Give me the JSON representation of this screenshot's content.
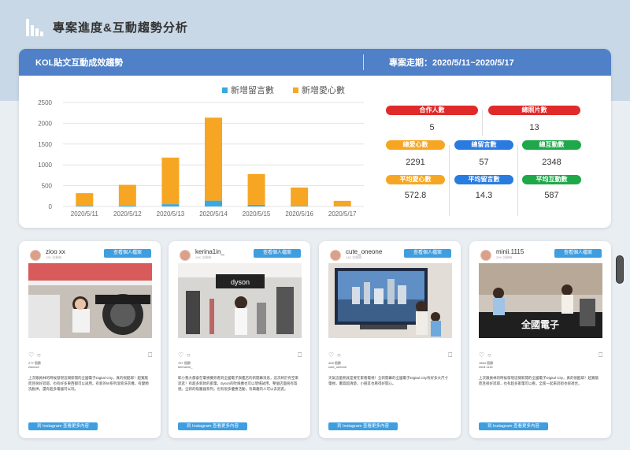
{
  "header": {
    "title": "專案進度&互動趨勢分析",
    "icon": "bar-chart-icon"
  },
  "panel": {
    "title": "KOL貼文互動成效趨勢",
    "period": "專案走期：2020/5/11~2020/5/17",
    "header_color": "#4f80c8"
  },
  "chart_data": {
    "type": "bar",
    "stacked": true,
    "categories": [
      "2020/5/11",
      "2020/5/12",
      "2020/5/13",
      "2020/5/14",
      "2020/5/15",
      "2020/5/16",
      "2020/5/17"
    ],
    "series": [
      {
        "name": "新增留言數",
        "color": "#3ba9e0",
        "values": [
          15,
          22,
          55,
          140,
          40,
          8,
          5
        ]
      },
      {
        "name": "新增愛心數",
        "color": "#f6a623",
        "values": [
          305,
          498,
          1120,
          1995,
          740,
          447,
          130
        ]
      }
    ],
    "ylim": [
      0,
      2500
    ],
    "yticks": [
      0,
      500,
      1000,
      1500,
      2000,
      2500
    ],
    "grid": true,
    "legend": "top"
  },
  "stats": {
    "partners_label": "合作人數",
    "partners_value": "5",
    "photos_label": "總照片數",
    "photos_value": "13",
    "hearts_label": "總愛心數",
    "hearts_value": "2291",
    "comments_label": "總留言數",
    "comments_value": "57",
    "interactions_label": "總互動數",
    "interactions_value": "2348",
    "avg_hearts_label": "平均愛心數",
    "avg_hearts_value": "572.8",
    "avg_comments_label": "平均留言數",
    "avg_comments_value": "14.3",
    "avg_interactions_label": "平均互動數",
    "avg_interactions_value": "587",
    "colors": {
      "red": "#e02a2a",
      "orange": "#f6a623",
      "blue": "#2a7be0",
      "green": "#1fa84a"
    }
  },
  "cards": [
    {
      "username": "zioo xx",
      "followers": "12K 位粉絲",
      "profile_button": "查看個人檔案",
      "likes": "277 個讚",
      "caption_user": "zioooxx",
      "caption": "上次跟員林的時候發現這間新開的全國電子Digital City，真的很酷耶！超寬敞而且很好逛耶，也有好多東西都可以試用。有新的W系列滾筒洗衣機，有變頻洗脫烘，還有超多電器可以玩。",
      "ig_button": "到 Instagram 查看更多內容"
    },
    {
      "username": "kerina1in_",
      "followers": "16K 位粉絲",
      "profile_button": "查看個人檔案",
      "likes": "767 個讚",
      "caption_user": "kerina1in_",
      "caption": "耶小我大都會在電視機旁看到全國電子旗艦店的新開幕消息，這次終於有空來逛逛！有超多新款的家電，dyson的吹風機也可以現場試用，整個店面很有質感。全新的吸塵器系列，也有很多優惠活動，有興趣的人可以去逛逛。",
      "ig_button": "到 Instagram 查看更多內容"
    },
    {
      "username": "cute_oneone",
      "followers": "14K 位粉絲",
      "profile_button": "查看個人檔案",
      "likes": "408 個讚",
      "caption_user": "cute_oneone",
      "caption": "天氣這麼熱就是要在家看電視！全新開幕的全國電子Digital City有好多大尺寸電視，畫質超清楚，小朋友也看得好開心。",
      "ig_button": "到 Instagram 查看更多內容"
    },
    {
      "username": "minii.1115",
      "followers": "20K 位粉絲",
      "profile_button": "查看個人檔案",
      "likes": "1664 個讚",
      "caption_user": "minii.1115",
      "caption": "上次跟員林的時候發現這間新開的全國電子Digital City，真的很酷耶！超寬敞而且很好逛耶，也有超多家電可以看，全家一起來逛街也很適合。",
      "ig_button": "到 Instagram 查看更多內容"
    }
  ]
}
